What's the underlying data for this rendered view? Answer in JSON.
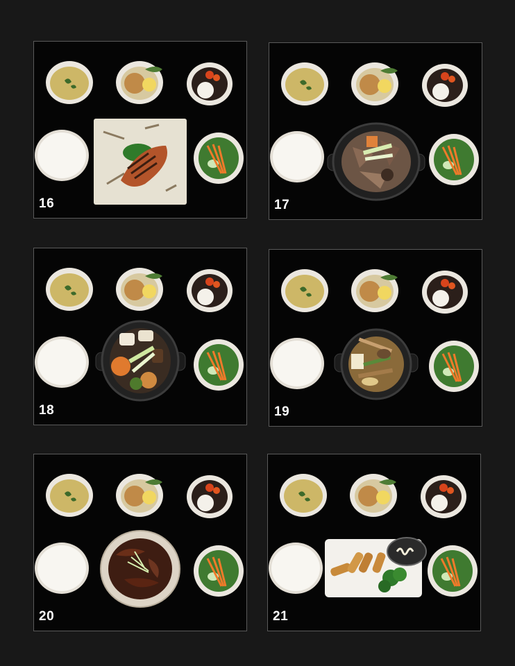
{
  "panels": [
    {
      "number": "16",
      "main": "grilled-fish-plate"
    },
    {
      "number": "17",
      "main": "sukiyaki-hotpot"
    },
    {
      "number": "18",
      "main": "vegetable-hotpot"
    },
    {
      "number": "19",
      "main": "tofu-hotpot"
    },
    {
      "number": "20",
      "main": "stew-bowl"
    },
    {
      "number": "21",
      "main": "fried-platter"
    }
  ],
  "colors": {
    "background": "#181818",
    "panel": "#050505",
    "panel_border": "#5a5a5a",
    "number_text": "#ffffff"
  }
}
